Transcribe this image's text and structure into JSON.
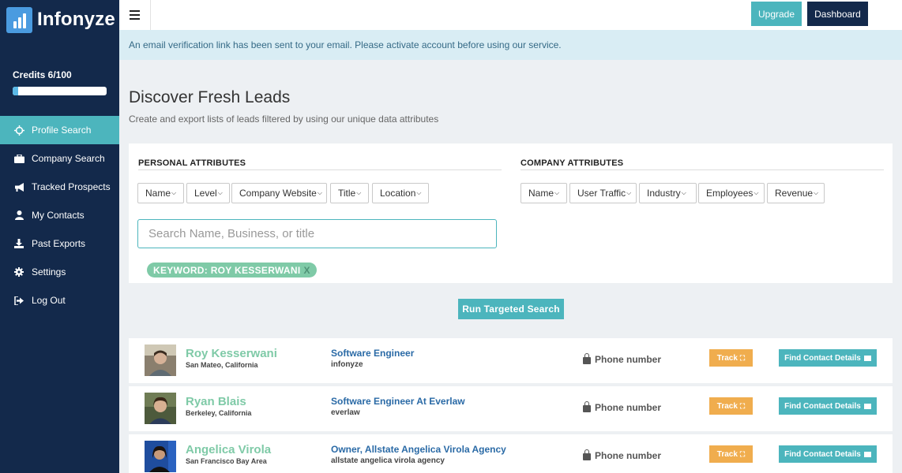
{
  "brand": {
    "name": "Infonyze"
  },
  "credits": {
    "label": "Credits 6/100",
    "used": 6,
    "total": 100
  },
  "nav": [
    {
      "label": "Profile Search",
      "icon": "crosshair-icon",
      "active": true
    },
    {
      "label": "Company Search",
      "icon": "briefcase-icon"
    },
    {
      "label": "Tracked Prospects",
      "icon": "megaphone-icon"
    },
    {
      "label": "My Contacts",
      "icon": "user-icon"
    },
    {
      "label": "Past Exports",
      "icon": "download-icon"
    },
    {
      "label": "Settings",
      "icon": "gear-icon"
    },
    {
      "label": "Log Out",
      "icon": "logout-icon"
    }
  ],
  "topbar": {
    "upgrade_label": "Upgrade",
    "dashboard_label": "Dashboard"
  },
  "alert": {
    "text": "An email verification link has been sent to your email. Please activate account before using our service."
  },
  "page": {
    "title": "Discover Fresh Leads",
    "subtitle": "Create and export lists of leads filtered by using our unique data attributes"
  },
  "filters": {
    "personal_title": "PERSONAL ATTRIBUTES",
    "company_title": "COMPANY ATTRIBUTES",
    "personal": [
      "Name",
      "Level",
      "Company Website",
      "Title",
      "Location"
    ],
    "company": [
      "Name",
      "User Traffic",
      "Industry",
      "Employees",
      "Revenue"
    ],
    "search_placeholder": "Search Name, Business, or title",
    "keyword_tag": "KEYWORD: ROY KESSERWANI",
    "keyword_remove": "X"
  },
  "run_search_label": "Run Targeted Search",
  "results": [
    {
      "name": "Roy Kesserwani",
      "location": "San Mateo, California",
      "title": "Software Engineer",
      "company": "infonyze",
      "phone_label": "Phone number",
      "track_label": "Track",
      "find_label": "Find Contact Details"
    },
    {
      "name": "Ryan Blais",
      "location": "Berkeley, California",
      "title": "Software Engineer At Everlaw",
      "company": "everlaw",
      "phone_label": "Phone number",
      "track_label": "Track",
      "find_label": "Find Contact Details"
    },
    {
      "name": "Angelica Virola",
      "location": "San Francisco Bay Area",
      "title": "Owner, Allstate Angelica Virola Agency",
      "company": "allstate angelica virola agency",
      "phone_label": "Phone number",
      "track_label": "Track",
      "find_label": "Find Contact Details"
    }
  ],
  "colors": {
    "sidebar": "#13294b",
    "accent": "#4cb5bd",
    "name_green": "#7fcaa7",
    "track_orange": "#f0ad4e",
    "link_blue": "#2a6aa6"
  }
}
